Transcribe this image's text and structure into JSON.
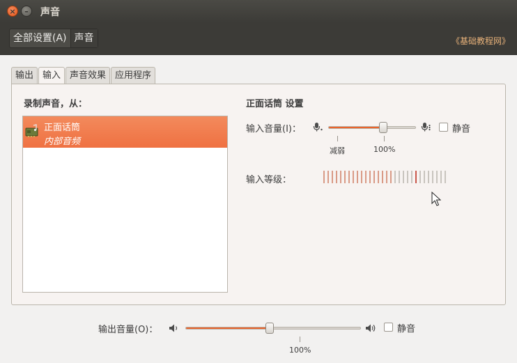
{
  "window": {
    "title": "声音",
    "close_glyph": "×",
    "minimize_glyph": "–"
  },
  "breadcrumb": {
    "items": [
      "全部设置(A)",
      "声音"
    ]
  },
  "watermark": "《基础教程网》",
  "tabs": [
    {
      "label": "输出",
      "active": false
    },
    {
      "label": "输入",
      "active": true
    },
    {
      "label": "声音效果",
      "active": false
    },
    {
      "label": "应用程序",
      "active": false
    }
  ],
  "input": {
    "record_from_title": "录制声音，从：",
    "devices": [
      {
        "name": "正面话筒",
        "description": "内部音频",
        "selected": true
      }
    ],
    "settings_title": "正面话筒 设置",
    "volume_label": "输入音量(I)：",
    "volume_fraction": 0.63,
    "tick_low_label": "减弱",
    "tick_100_label": "100%",
    "mute_label": "静音",
    "mute_checked": false,
    "level_label": "输入等级：",
    "level_bars_total": 30,
    "level_bars_lit": 17,
    "level_peak_index": 22
  },
  "output": {
    "volume_label": "输出音量(O)：",
    "volume_fraction": 0.48,
    "tick_100_label": "100%",
    "mute_label": "静音",
    "mute_checked": false
  },
  "colors": {
    "accent": "#e9642c",
    "selection": "#f07746",
    "titlebar": "#3c3b37",
    "watermark": "#e8b27a"
  },
  "icons": [
    "close-icon",
    "minimize-icon",
    "microphone-low-icon",
    "microphone-high-icon",
    "speaker-low-icon",
    "speaker-high-icon",
    "sound-card-icon",
    "mouse-pointer-icon"
  ]
}
